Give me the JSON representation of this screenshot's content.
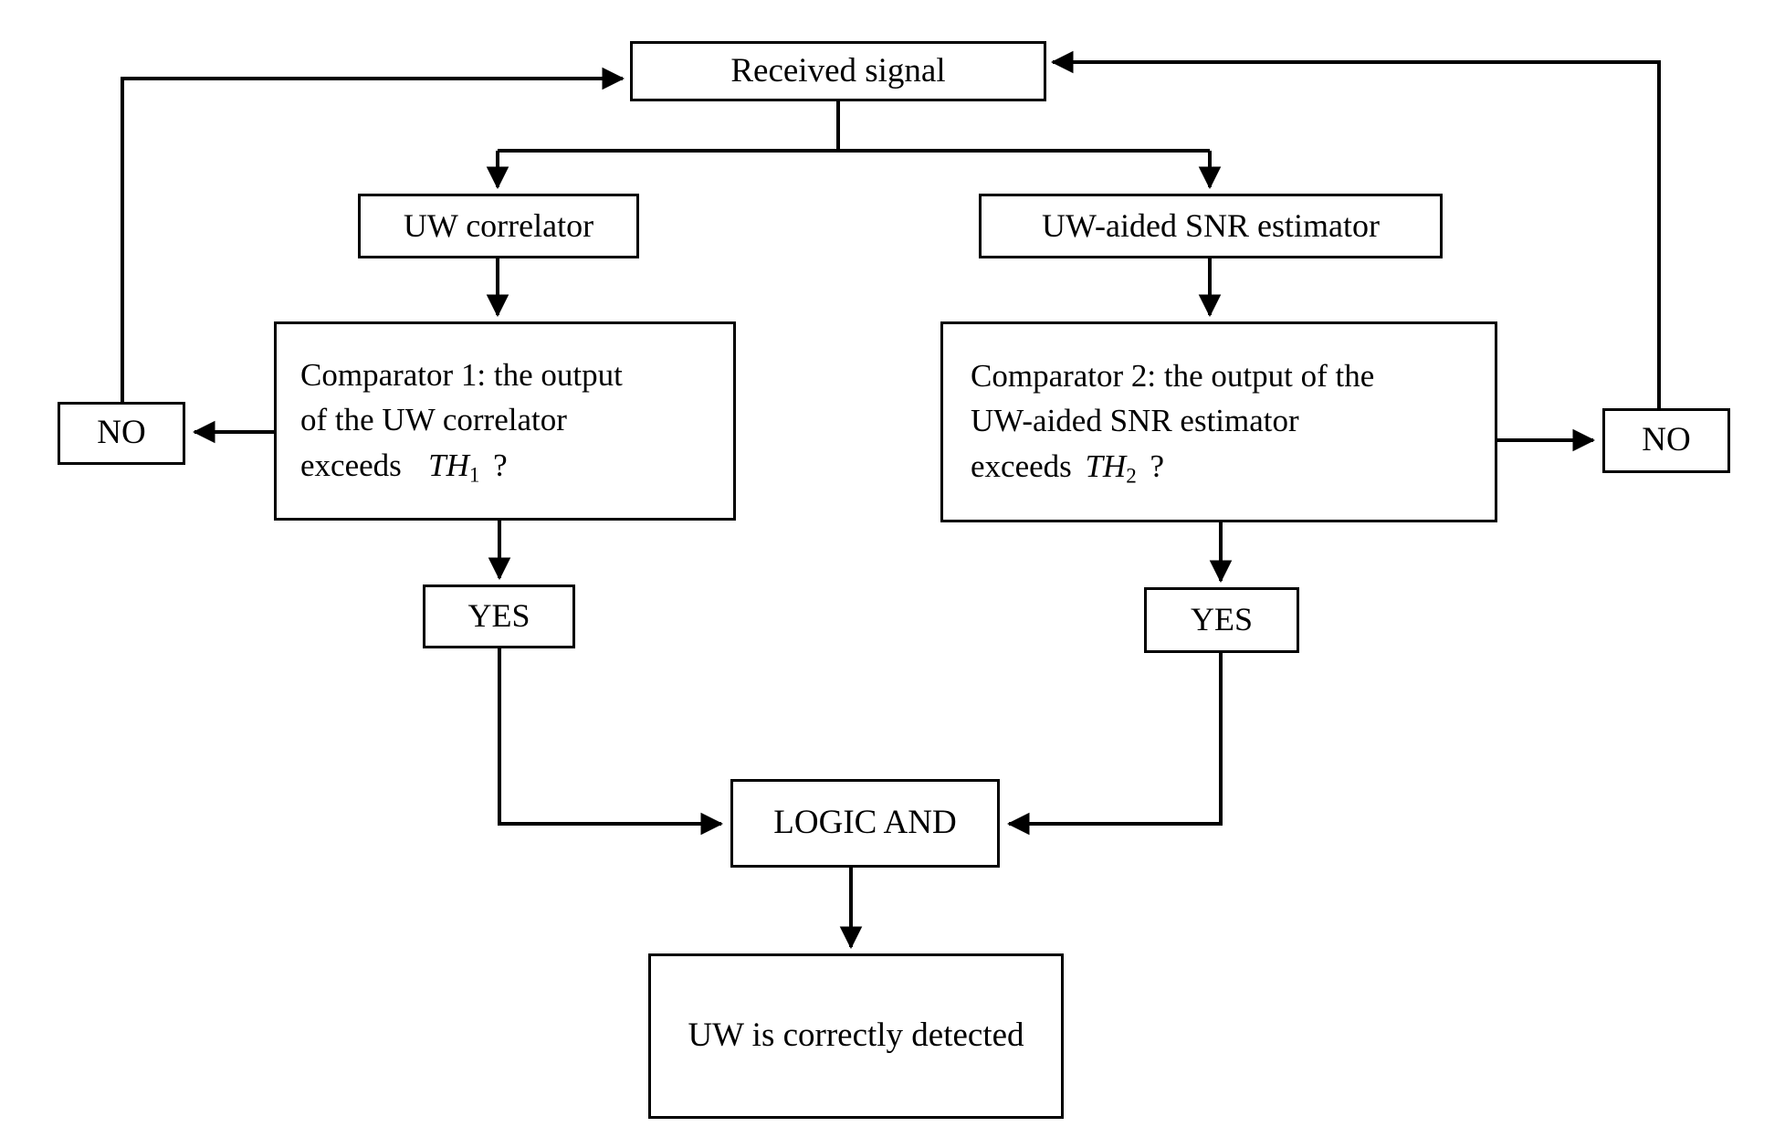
{
  "diagram": {
    "title": "UW detection flowchart",
    "line_color": "#000000",
    "box_border_color": "#000000",
    "box_fill_color": "#ffffff",
    "background_color": "#ffffff"
  },
  "nodes": {
    "received_signal": {
      "label": "Received signal"
    },
    "uw_correlator": {
      "label": "UW correlator"
    },
    "snr_estimator": {
      "label": "UW-aided SNR estimator"
    },
    "comparator1": {
      "line1": "Comparator 1: the output",
      "line2": "of the UW correlator",
      "line3_prefix": "exceeds",
      "line3_var": "TH",
      "line3_sub": "1",
      "line3_suffix": "?"
    },
    "comparator2": {
      "line1": "Comparator 2: the output of the",
      "line2": "UW-aided SNR estimator",
      "line3_prefix": "exceeds",
      "line3_var": "TH",
      "line3_sub": "2",
      "line3_suffix": "?"
    },
    "no_left": {
      "label": "NO"
    },
    "no_right": {
      "label": "NO"
    },
    "yes_left": {
      "label": "YES"
    },
    "yes_right": {
      "label": "YES"
    },
    "logic_and": {
      "label": "LOGIC AND"
    },
    "result": {
      "label": "UW is correctly detected"
    }
  },
  "edges": [
    {
      "from": "no_left",
      "to": "received_signal",
      "label": ""
    },
    {
      "from": "no_right",
      "to": "received_signal",
      "label": ""
    },
    {
      "from": "received_signal",
      "to": "uw_correlator",
      "label": ""
    },
    {
      "from": "received_signal",
      "to": "snr_estimator",
      "label": ""
    },
    {
      "from": "uw_correlator",
      "to": "comparator1",
      "label": ""
    },
    {
      "from": "snr_estimator",
      "to": "comparator2",
      "label": ""
    },
    {
      "from": "comparator1",
      "to": "no_left",
      "label": ""
    },
    {
      "from": "comparator1",
      "to": "yes_left",
      "label": ""
    },
    {
      "from": "comparator2",
      "to": "no_right",
      "label": ""
    },
    {
      "from": "comparator2",
      "to": "yes_right",
      "label": ""
    },
    {
      "from": "yes_left",
      "to": "logic_and",
      "label": ""
    },
    {
      "from": "yes_right",
      "to": "logic_and",
      "label": ""
    },
    {
      "from": "logic_and",
      "to": "result",
      "label": ""
    }
  ]
}
